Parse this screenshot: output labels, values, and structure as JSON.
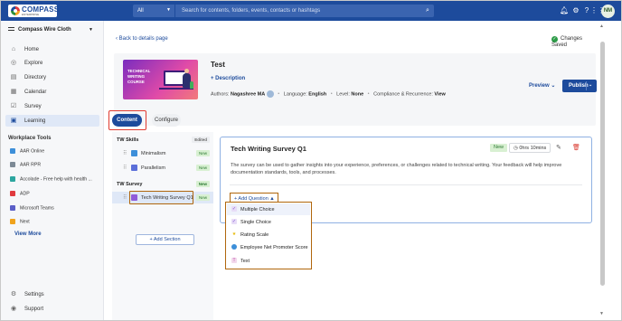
{
  "topbar": {
    "logo_text": "COMPASS",
    "logo_sub": "ENTERPRISE",
    "search_category": "All",
    "search_placeholder": "Search for contents, folders, events, contacts or hashtags",
    "avatar": "NM",
    "icons": [
      "bell-icon",
      "gear-icon",
      "help-icon",
      "grid-icon"
    ]
  },
  "sidebar": {
    "org": "Compass Wire Cloth",
    "nav": [
      {
        "label": "Home",
        "icon": "home-icon"
      },
      {
        "label": "Explore",
        "icon": "compass-icon"
      },
      {
        "label": "Directory",
        "icon": "directory-icon"
      },
      {
        "label": "Calendar",
        "icon": "calendar-icon"
      },
      {
        "label": "Survey",
        "icon": "survey-icon"
      },
      {
        "label": "Learning",
        "icon": "learning-icon"
      }
    ],
    "tools_heading": "Workplace Tools",
    "tools": [
      {
        "label": "AAR Online",
        "color": "#3d8fd9"
      },
      {
        "label": "AAR RPR",
        "color": "#7d8a96"
      },
      {
        "label": "Accolade - Free help with health ...",
        "color": "#2da6a0"
      },
      {
        "label": "ADP",
        "color": "#e03a3e"
      },
      {
        "label": "Microsoft Teams",
        "color": "#5b5fc7"
      },
      {
        "label": "Next",
        "color": "#f0a31d"
      }
    ],
    "view_more": "View More",
    "bottom": [
      {
        "label": "Settings",
        "icon": "gear-icon"
      },
      {
        "label": "Support",
        "icon": "support-icon"
      }
    ]
  },
  "main": {
    "back_link": "Back to details page",
    "saved_status": "Changes Saved",
    "course": {
      "thumb_text": "TECHNICAL WRITING COURSE",
      "title": "Test",
      "description_link": "+ Description",
      "authors_label": "Authors:",
      "authors_value": "Nagashree MA",
      "language_label": "Language:",
      "language_value": "English",
      "level_label": "Level:",
      "level_value": "None",
      "compliance_label": "Compliance & Recurrence:",
      "compliance_value": "View"
    },
    "preview_label": "Preview",
    "publish_label": "Publish",
    "tabs": {
      "content": "Content",
      "configure": "Configure"
    },
    "structure": {
      "sections": [
        {
          "name": "TW Skills",
          "badge": "Edited",
          "items": [
            {
              "name": "Minimalism",
              "badge": "New",
              "icon_color": "#3d8fd9"
            },
            {
              "name": "Parallelism",
              "badge": "New",
              "icon_color": "#5b6fd9"
            }
          ]
        },
        {
          "name": "TW Survey",
          "badge": "New",
          "items": [
            {
              "name": "Tech Writing Survey Q1",
              "badge": "New",
              "icon_color": "#8f5bd9"
            }
          ]
        }
      ],
      "add_section": "+ Add Section"
    },
    "survey": {
      "title": "Tech Writing Survey Q1",
      "badge": "New",
      "duration": "0hrs 10mins",
      "description": "The survey can be used to gather insights into your experience, preferences, or challenges related to technical writing. Your feedback will help improve documentation standards, tools, and processes.",
      "add_question": "+ Add Question"
    },
    "question_types": [
      {
        "label": "Multiple Choice",
        "icon": "check-icon",
        "color": "#7b4fd1"
      },
      {
        "label": "Single Choice",
        "icon": "check-icon",
        "color": "#7b4fd1"
      },
      {
        "label": "Rating Scale",
        "icon": "star-icon",
        "color": "#e6b800"
      },
      {
        "label": "Employee Net Promoter Score",
        "icon": "enps-icon",
        "color": "#3d8fd9"
      },
      {
        "label": "Text",
        "icon": "text-icon",
        "color": "#c45bb0"
      }
    ]
  }
}
